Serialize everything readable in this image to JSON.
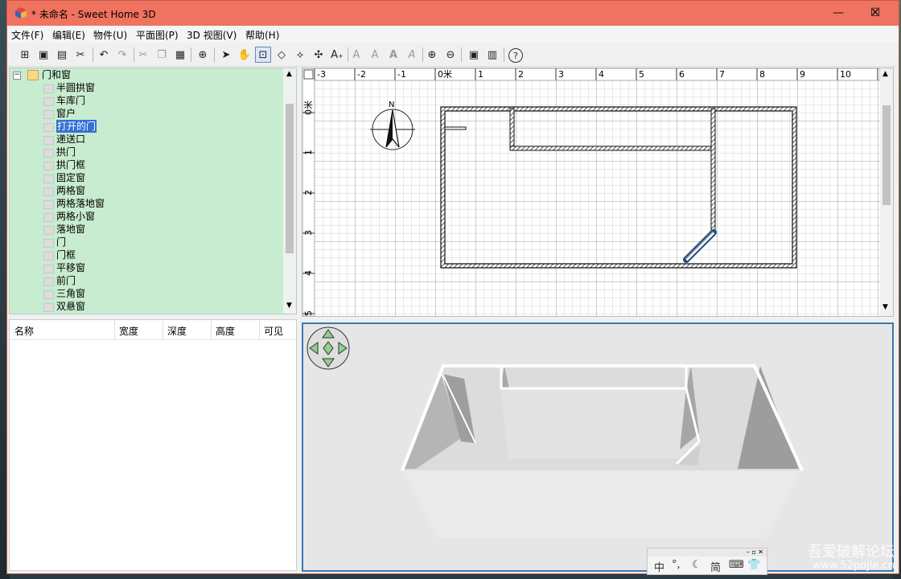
{
  "window": {
    "title": "* 未命名 - Sweet Home 3D",
    "minimize": "—",
    "maximize": "☐",
    "close": "✕"
  },
  "menu": [
    "文件(F)",
    "编辑(E)",
    "物件(U)",
    "平面图(P)",
    "3D 视图(V)",
    "帮助(H)"
  ],
  "catalog": {
    "category": "门和窗",
    "items": [
      "半圆拱窗",
      "车库门",
      "窗户",
      "打开的门",
      "递送口",
      "拱门",
      "拱门框",
      "固定窗",
      "两格窗",
      "两格落地窗",
      "两格小窗",
      "落地窗",
      "门",
      "门框",
      "平移窗",
      "前门",
      "三角窗",
      "双悬窗"
    ],
    "selected_index": 3
  },
  "furniture_table": {
    "columns": [
      "名称",
      "宽度",
      "深度",
      "高度",
      "可见"
    ]
  },
  "plan": {
    "x_ticks": [
      "-3",
      "-2",
      "-1",
      "0米",
      "1",
      "2",
      "3",
      "4",
      "5",
      "6",
      "7",
      "8",
      "9",
      "10",
      "1"
    ],
    "y_ticks": [
      "0米",
      "1",
      "2",
      "3",
      "4",
      "5"
    ],
    "compass_label": "N"
  },
  "ime": {
    "items": [
      "中",
      "°,",
      "☾",
      "简",
      "⌨",
      "👕"
    ]
  },
  "watermark": {
    "line1": "吾爱破解论坛",
    "line2": "www.52pojie.cn"
  },
  "colors": {
    "titlebar": "#f0735f",
    "catalog_bg": "#c8ecd0",
    "selection": "#3271d6",
    "view_border": "#3a78b4"
  }
}
